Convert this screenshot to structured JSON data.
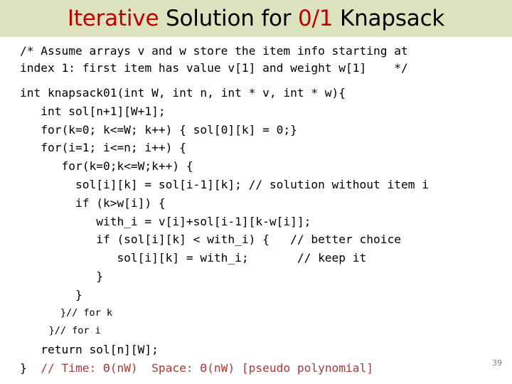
{
  "title": {
    "part1": "Iterative",
    "part1_color": "#c00000",
    "part2": " Solution for ",
    "part2_color": "#000000",
    "part3": "0/1",
    "part3_color": "#c00000",
    "part4": " Knapsack",
    "part4_color": "#000000",
    "band_color": "#dce3be"
  },
  "comment_block": [
    "/* Assume arrays v and w store the item info starting at",
    "index 1: first item has value v[1] and weight w[1]    */"
  ],
  "code": [
    {
      "text": "int knapsack01(int W, int n, int * v, int * w){",
      "style": "normal"
    },
    {
      "text": "   int sol[n+1][W+1];",
      "style": "normal"
    },
    {
      "text": "   for(k=0; k<=W; k++) { sol[0][k] = 0;}",
      "style": "normal"
    },
    {
      "text": "   for(i=1; i<=n; i++) {",
      "style": "normal"
    },
    {
      "text": "      for(k=0;k<=W;k++) {",
      "style": "normal"
    },
    {
      "text": "        sol[i][k] = sol[i-1][k]; // solution without item i",
      "style": "normal"
    },
    {
      "text": "        if (k>w[i]) {",
      "style": "normal"
    },
    {
      "text": "           with_i = v[i]+sol[i-1][k-w[i]];",
      "style": "normal"
    },
    {
      "text": "           if (sol[i][k] < with_i) {   // better choice",
      "style": "normal"
    },
    {
      "text": "              sol[i][k] = with_i;       // keep it",
      "style": "normal"
    },
    {
      "text": "           }",
      "style": "normal"
    },
    {
      "text": "        }",
      "style": "normal"
    },
    {
      "text": "       }// for k",
      "style": "small"
    },
    {
      "text": "     }// for i",
      "style": "small"
    },
    {
      "text": "   return sol[n][W];",
      "style": "normal"
    }
  ],
  "last_line": {
    "brace": "}",
    "comment": "  // Time: Θ(nW)  Space: Θ(nW) [pseudo polynomial]",
    "comment_color": "#a83a3a"
  },
  "page_number": "39"
}
